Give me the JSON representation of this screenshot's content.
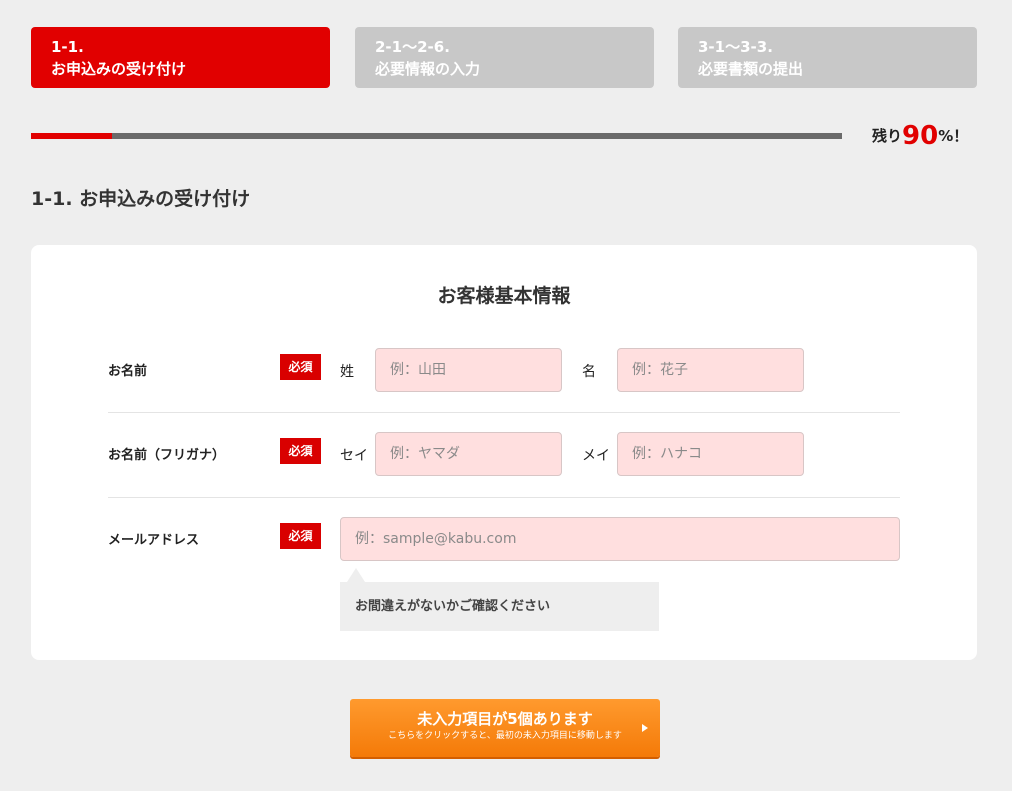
{
  "steps": [
    {
      "num": "1-1.",
      "title": "お申込みの受け付け",
      "active": true
    },
    {
      "num": "2-1〜2-6.",
      "title": "必要情報の入力",
      "active": false
    },
    {
      "num": "3-1〜3-3.",
      "title": "必要書類の提出",
      "active": false
    }
  ],
  "progress": {
    "completed_fraction": 0.1,
    "prefix": "残り",
    "percent": "90",
    "suffix": "%！"
  },
  "section_title": "1-1. お申込みの受け付け",
  "card": {
    "title": "お客様基本情報",
    "required_label": "必須",
    "rows": {
      "name": {
        "label": "お名前",
        "last_label": "姓",
        "last_placeholder": "例：山田",
        "first_label": "名",
        "first_placeholder": "例：花子"
      },
      "kana": {
        "label": "お名前（フリガナ）",
        "last_label": "セイ",
        "last_placeholder": "例：ヤマダ",
        "first_label": "メイ",
        "first_placeholder": "例：ハナコ"
      },
      "email": {
        "label": "メールアドレス",
        "placeholder": "例：sample@kabu.com",
        "hint": "お間違えがないかご確認ください"
      }
    }
  },
  "submit": {
    "main": "未入力項目が5個あります",
    "sub": "こちらをクリックすると、最初の未入力項目に移動します"
  },
  "colors": {
    "accent": "#e10000",
    "inactive_step": "#c8c8c8",
    "field_bg": "#ffdfdf",
    "button": "#f7870f"
  }
}
